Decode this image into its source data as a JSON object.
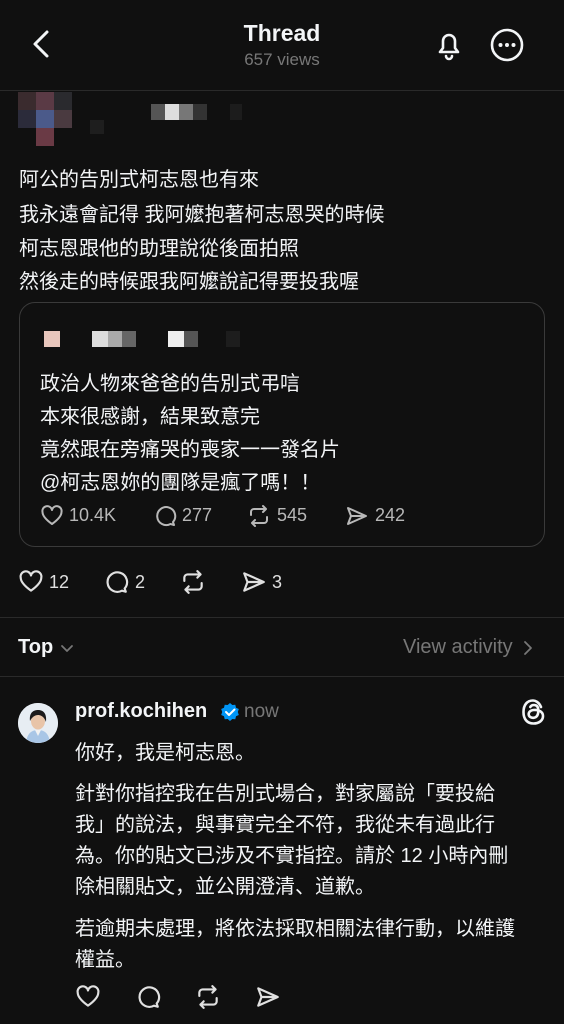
{
  "header": {
    "title": "Thread",
    "views": "657 views"
  },
  "post": {
    "lines": [
      "阿公的告別式柯志恩也有來",
      "我永遠會記得 我阿嬤抱著柯志恩哭的時候",
      "柯志恩跟他的助理說從後面拍照",
      "然後走的時候跟我阿嬤說記得要投我喔"
    ],
    "quoted": {
      "lines": [
        "政治人物來爸爸的告別式弔唁",
        "本來很感謝，結果致意完",
        "竟然跟在旁痛哭的喪家一一發名片",
        "@柯志恩妳的團隊是瘋了嗎！！"
      ],
      "likes": "10.4K",
      "replies": "277",
      "reposts": "545",
      "shares": "242"
    },
    "likes": "12",
    "replies": "2",
    "shares": "3"
  },
  "sort": {
    "label": "Top",
    "view_activity": "View activity"
  },
  "reply": {
    "username": "prof.kochihen",
    "time": "now",
    "paragraphs": [
      [
        "你好，我是柯志恩。"
      ],
      [
        "針對你指控我在告別式場合，對家屬說「要投給",
        "我」的說法，與事實完全不符，我從未有過此行",
        "為。你的貼文已涉及不實指控。請於 12 小時內刪",
        "除相關貼文，並公開澄清、道歉。"
      ],
      [
        "若逾期未處理，將依法採取相關法律行動，以維護",
        "權益。"
      ]
    ]
  },
  "colors": {
    "background": "#101010",
    "text": "#f3f5f7",
    "secondary": "#777777",
    "verified": "#0095f6"
  }
}
